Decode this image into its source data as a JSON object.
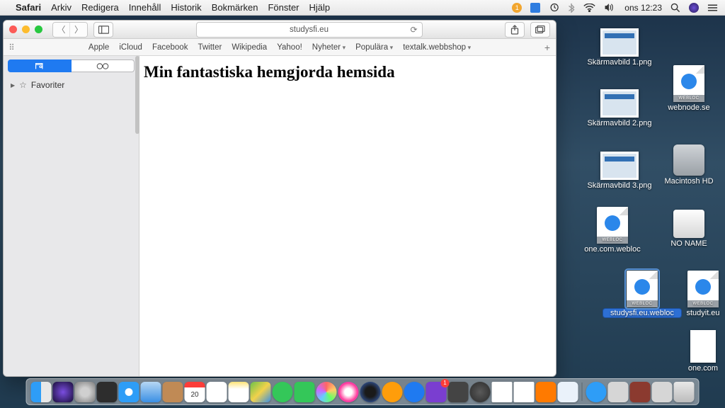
{
  "menubar": {
    "app": "Safari",
    "items": [
      "Arkiv",
      "Redigera",
      "Innehåll",
      "Historik",
      "Bokmärken",
      "Fönster",
      "Hjälp"
    ],
    "clock": "ons 12:23"
  },
  "safari": {
    "url": "studysfi.eu",
    "bookmark_bar": [
      "Apple",
      "iCloud",
      "Facebook",
      "Twitter",
      "Wikipedia",
      "Yahoo!",
      "Nyheter",
      "Populära",
      "textalk.webbshop"
    ],
    "bookmark_dropdowns": [
      false,
      false,
      false,
      false,
      false,
      false,
      true,
      true,
      true
    ],
    "sidebar": {
      "fav_label": "Favoriter"
    },
    "page": {
      "heading": "Min fantastiska hemgjorda hemsida"
    }
  },
  "desktop": {
    "icons": [
      {
        "name": "Skärmavbild 1.png"
      },
      {
        "name": "Skärmavbild 2.png"
      },
      {
        "name": "Skärmavbild 3.png"
      },
      {
        "name": "webnode.se"
      },
      {
        "name": "Macintosh HD"
      },
      {
        "name": "one.com.webloc"
      },
      {
        "name": "NO NAME"
      },
      {
        "name": "studysfi.eu.webloc"
      },
      {
        "name": "studyit.eu"
      },
      {
        "name": "one.com"
      }
    ]
  }
}
